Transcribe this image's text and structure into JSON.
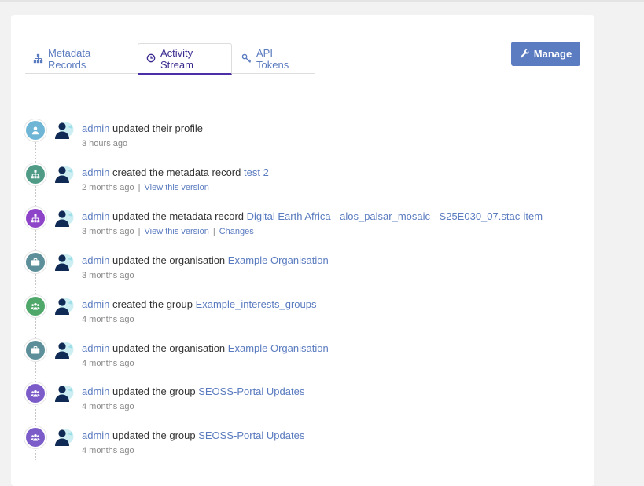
{
  "tabs": [
    {
      "label": "Metadata Records",
      "icon": "sitemap-icon"
    },
    {
      "label": "Activity Stream",
      "icon": "clock-icon"
    },
    {
      "label": "API Tokens",
      "icon": "key-icon"
    }
  ],
  "manage": {
    "label": "Manage",
    "icon": "wrench-icon"
  },
  "colors": {
    "link": "#5a7bbf",
    "tab_active_border": "#4b2fa6",
    "manage_bg": "#5c7cc1",
    "user_badge": "#6fb6d6",
    "dataset_badge": "#4f9b86",
    "dataset_purple_badge": "#8e44c9",
    "org_badge": "#5c8f99",
    "group_badge": "#4fa86a",
    "group_purple_badge": "#7b5cc8"
  },
  "activities": [
    {
      "badge": "user-icon",
      "badge_color": "#6fb6d6",
      "actor": "admin",
      "action": "updated their profile",
      "object": "",
      "time": "3 hours ago",
      "links": []
    },
    {
      "badge": "sitemap-icon",
      "badge_color": "#4f9b86",
      "actor": "admin",
      "action": "created the metadata record",
      "object": "test 2",
      "time": "2 months ago",
      "links": [
        "View this version"
      ]
    },
    {
      "badge": "sitemap-icon",
      "badge_color": "#8e44c9",
      "actor": "admin",
      "action": "updated the metadata record",
      "object": "Digital Earth Africa - alos_palsar_mosaic - S25E030_07.stac-item",
      "time": "3 months ago",
      "links": [
        "View this version",
        "Changes"
      ]
    },
    {
      "badge": "briefcase-icon",
      "badge_color": "#5c8f99",
      "actor": "admin",
      "action": "updated the organisation",
      "object": "Example Organisation",
      "time": "3 months ago",
      "links": []
    },
    {
      "badge": "users-icon",
      "badge_color": "#4fa86a",
      "actor": "admin",
      "action": "created the group",
      "object": "Example_interests_groups",
      "time": "4 months ago",
      "links": []
    },
    {
      "badge": "briefcase-icon",
      "badge_color": "#5c8f99",
      "actor": "admin",
      "action": "updated the organisation",
      "object": "Example Organisation",
      "time": "4 months ago",
      "links": []
    },
    {
      "badge": "users-icon",
      "badge_color": "#7b5cc8",
      "actor": "admin",
      "action": "updated the group",
      "object": "SEOSS-Portal Updates",
      "time": "4 months ago",
      "links": []
    },
    {
      "badge": "users-icon",
      "badge_color": "#7b5cc8",
      "actor": "admin",
      "action": "updated the group",
      "object": "SEOSS-Portal Updates",
      "time": "4 months ago",
      "links": []
    }
  ]
}
